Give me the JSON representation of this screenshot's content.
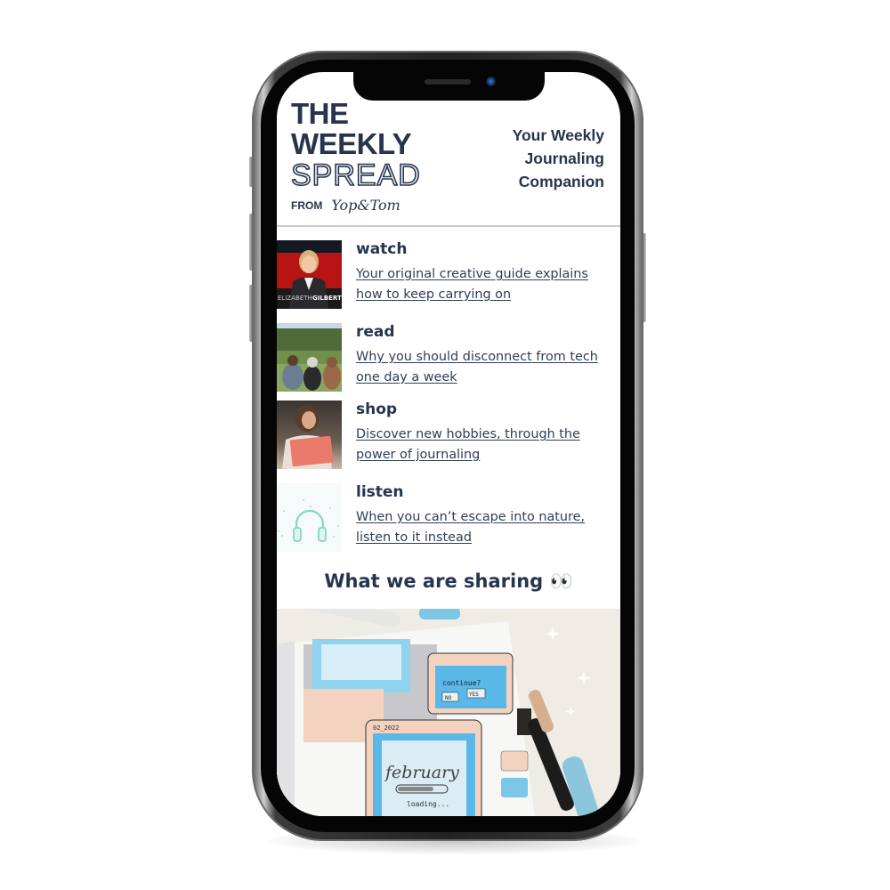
{
  "newsletter": {
    "logo": {
      "line1": "THE",
      "line2": "WEEKLY",
      "line3": "SPREAD",
      "from_label": "FROM",
      "brand": "Yop&Tom"
    },
    "tagline": [
      "Your Weekly",
      "Journaling",
      "Companion"
    ],
    "features": [
      {
        "category": "watch",
        "link_text": "Your original creative guide explains how to keep carrying on",
        "thumbnail": "Elizabeth Gilbert talk",
        "thumbnail_caption_light": "ELIZABETH",
        "thumbnail_caption_bold": "GILBERT"
      },
      {
        "category": "read",
        "link_text": "Why you should disconnect from tech one day a week",
        "thumbnail": "friends sitting on grass outdoors"
      },
      {
        "category": "shop",
        "link_text": "Discover new hobbies, through the power of journaling",
        "thumbnail": "woman reading a pink journal"
      },
      {
        "category": "listen",
        "link_text": "When you can’t escape into nature, listen to it instead",
        "thumbnail": "headphones-icon"
      }
    ],
    "section_title": "What we are sharing",
    "section_emoji": "👀",
    "hero_image": {
      "description": "bullet journal spread styled like a computer window",
      "texts": [
        "continue?",
        "NO",
        "YES",
        "02_2022",
        "february",
        "loading..."
      ]
    }
  },
  "colors": {
    "navy": "#26354d",
    "divider": "#c9cbd0",
    "headphone_mint": "#7ddcbc"
  }
}
